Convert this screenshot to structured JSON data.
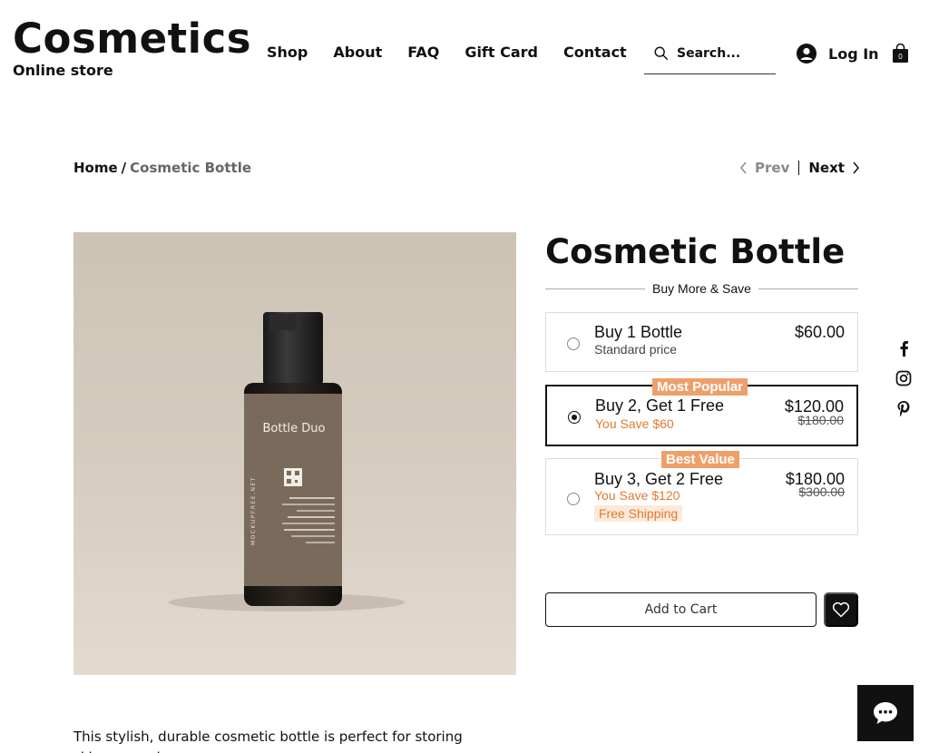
{
  "brand": {
    "title": "Cosmetics",
    "subtitle": "Online store"
  },
  "nav": {
    "items": [
      "Shop",
      "About",
      "FAQ",
      "Gift Card",
      "Contact"
    ]
  },
  "search": {
    "placeholder": "Search..."
  },
  "account": {
    "login_label": "Log In"
  },
  "cart": {
    "count": "0"
  },
  "breadcrumb": {
    "home": "Home",
    "separator": "/",
    "current": "Cosmetic Bottle"
  },
  "pager": {
    "prev": "Prev",
    "next": "Next"
  },
  "product": {
    "image": {
      "label": "Bottle Duo",
      "side_text": "MOCKUPFREE.NET"
    },
    "title": "Cosmetic Bottle",
    "bundle_heading": "Buy More & Save",
    "options": [
      {
        "name": "Buy 1 Bottle",
        "sub": "Standard price",
        "price": "$60.00",
        "selected": false
      },
      {
        "tag": "Most Popular",
        "name": "Buy 2, Get 1 Free",
        "save": "You Save $60",
        "price": "$120.00",
        "old_price": "$180.00",
        "selected": true
      },
      {
        "tag": "Best Value",
        "name": "Buy 3, Get 2 Free",
        "save": "You Save $120",
        "badge": "Free Shipping",
        "price": "$180.00",
        "old_price": "$300.00",
        "selected": false
      }
    ],
    "add_to_cart": "Add to Cart",
    "description": "This stylish, durable cosmetic bottle is perfect for storing skincare and ..."
  },
  "colors": {
    "accent_orange": "#eea06b",
    "save_text": "#e07a2e",
    "text": "#111111"
  },
  "icons": [
    "search-icon",
    "account-icon",
    "cart-bag-icon",
    "chevron-left-icon",
    "chevron-right-icon",
    "heart-icon",
    "facebook-icon",
    "instagram-icon",
    "pinterest-icon",
    "chat-icon"
  ]
}
